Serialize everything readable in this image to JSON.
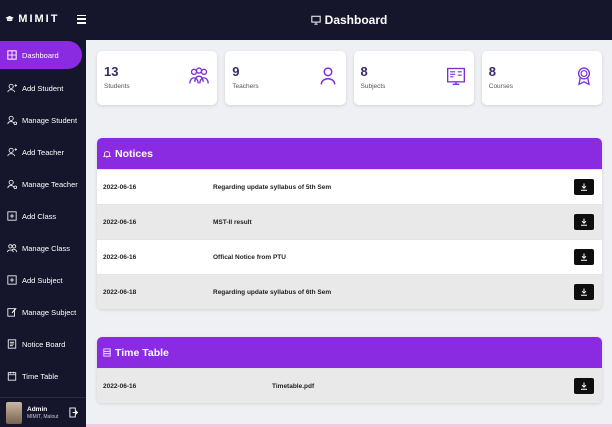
{
  "brand": {
    "name": "MIMIT"
  },
  "header": {
    "title": "Dashboard"
  },
  "sidebar": {
    "items": [
      {
        "label": "Dashboard",
        "icon": "grid-icon"
      },
      {
        "label": "Add Student",
        "icon": "user-plus-icon"
      },
      {
        "label": "Manage Student",
        "icon": "user-gear-icon"
      },
      {
        "label": "Add Teacher",
        "icon": "user-plus-icon"
      },
      {
        "label": "Manage Teacher",
        "icon": "user-gear-icon"
      },
      {
        "label": "Add Class",
        "icon": "plus-square-icon"
      },
      {
        "label": "Manage Class",
        "icon": "users-icon"
      },
      {
        "label": "Add Subject",
        "icon": "plus-square-icon"
      },
      {
        "label": "Manage Subject",
        "icon": "edit-icon"
      },
      {
        "label": "Notice Board",
        "icon": "board-icon"
      },
      {
        "label": "Time Table",
        "icon": "calendar-icon"
      }
    ]
  },
  "user": {
    "name": "Admin",
    "subtitle": "MIMIT, Malout"
  },
  "stats": [
    {
      "value": "13",
      "label": "Students",
      "icon": "students-icon"
    },
    {
      "value": "9",
      "label": "Teachers",
      "icon": "teacher-icon"
    },
    {
      "value": "8",
      "label": "Subjects",
      "icon": "subjects-icon"
    },
    {
      "value": "8",
      "label": "Courses",
      "icon": "award-icon"
    }
  ],
  "notices": {
    "title": "Notices",
    "rows": [
      {
        "date": "2022-06-16",
        "text": "Regarding update syllabus of 5th Sem"
      },
      {
        "date": "2022-06-16",
        "text": "MST-II result"
      },
      {
        "date": "2022-06-16",
        "text": "Offical Notice from PTU"
      },
      {
        "date": "2022-06-18",
        "text": "Regarding update syllabus of 6th Sem"
      }
    ]
  },
  "timetable": {
    "title": "Time Table",
    "rows": [
      {
        "date": "2022-06-16",
        "text": "Timetable.pdf"
      }
    ]
  },
  "colors": {
    "accent": "#8a2be2",
    "sidebar": "#15152b",
    "background": "#eef0f3",
    "icon": "#7b2fd6"
  }
}
